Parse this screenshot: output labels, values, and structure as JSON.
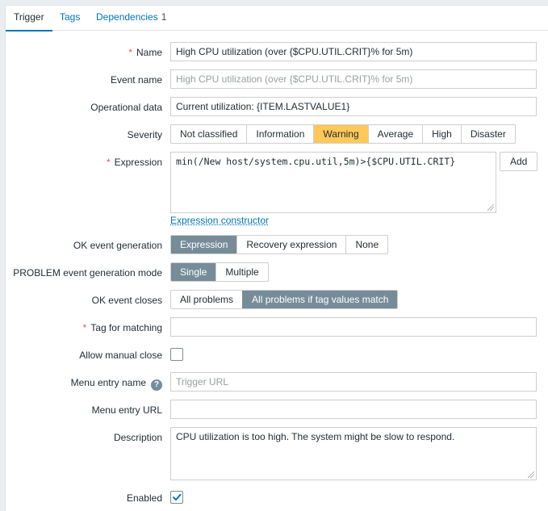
{
  "tabs": {
    "trigger": "Trigger",
    "tags": "Tags",
    "dependencies": "Dependencies",
    "dependencies_count": "1"
  },
  "form": {
    "name": {
      "label": "Name",
      "value": "High CPU utilization (over {$CPU.UTIL.CRIT}% for 5m)"
    },
    "event_name": {
      "label": "Event name",
      "placeholder": "High CPU utilization (over {$CPU.UTIL.CRIT}% for 5m)"
    },
    "operational_data": {
      "label": "Operational data",
      "value": "Current utilization: {ITEM.LASTVALUE1}"
    },
    "severity": {
      "label": "Severity",
      "options": [
        "Not classified",
        "Information",
        "Warning",
        "Average",
        "High",
        "Disaster"
      ],
      "selected": "Warning"
    },
    "expression": {
      "label": "Expression",
      "value": "min(/New host/system.cpu.util,5m)>{$CPU.UTIL.CRIT}",
      "add_button": "Add",
      "constructor_link": "Expression constructor"
    },
    "ok_event_generation": {
      "label": "OK event generation",
      "options": [
        "Expression",
        "Recovery expression",
        "None"
      ],
      "selected": "Expression"
    },
    "problem_mode": {
      "label": "PROBLEM event generation mode",
      "options": [
        "Single",
        "Multiple"
      ],
      "selected": "Single"
    },
    "ok_event_closes": {
      "label": "OK event closes",
      "options": [
        "All problems",
        "All problems if tag values match"
      ],
      "selected": "All problems if tag values match"
    },
    "tag_for_matching": {
      "label": "Tag for matching",
      "value": ""
    },
    "allow_manual_close": {
      "label": "Allow manual close",
      "checked": false
    },
    "menu_entry_name": {
      "label": "Menu entry name",
      "placeholder": "Trigger URL",
      "help": "?"
    },
    "menu_entry_url": {
      "label": "Menu entry URL",
      "value": ""
    },
    "description": {
      "label": "Description",
      "value": "CPU utilization is too high. The system might be slow to respond."
    },
    "enabled": {
      "label": "Enabled",
      "checked": true
    }
  },
  "colors": {
    "accent": "#0275b8",
    "selected_segment": "#768d99",
    "warning": "#ffc859",
    "required": "#e45959"
  }
}
